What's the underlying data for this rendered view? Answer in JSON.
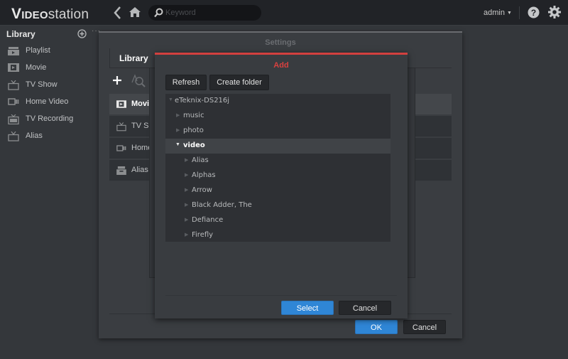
{
  "app": {
    "logo_v": "V",
    "logo_ideo": "IDEO",
    "logo_station": "station",
    "search_placeholder": "Keyword",
    "user": "admin",
    "icons": [
      "back-icon",
      "home-icon",
      "search-icon",
      "help-icon",
      "gear-icon"
    ]
  },
  "sidebar": {
    "title": "Library",
    "more": "···",
    "items": [
      {
        "label": "Playlist",
        "icon": "playlist-icon"
      },
      {
        "label": "Movie",
        "icon": "movie-icon"
      },
      {
        "label": "TV Show",
        "icon": "tv-icon"
      },
      {
        "label": "Home Video",
        "icon": "camera-icon"
      },
      {
        "label": "TV Recording",
        "icon": "tv-recording-icon"
      },
      {
        "label": "Alias",
        "icon": "tv-icon"
      }
    ]
  },
  "settings": {
    "title": "Settings",
    "tabs": [
      {
        "label": "Library"
      }
    ],
    "library_list": [
      {
        "label": "Movie",
        "selected": true
      },
      {
        "label": "TV Sh"
      },
      {
        "label": "Home"
      },
      {
        "label": "Alias"
      }
    ],
    "ok_label": "OK",
    "cancel_label": "Cancel"
  },
  "add_dialog": {
    "title": "Add",
    "refresh_label": "Refresh",
    "create_folder_label": "Create folder",
    "tree": [
      {
        "label": "eTeknix-DS216j",
        "level": 0,
        "expanded": true
      },
      {
        "label": "music",
        "level": 1,
        "expanded": false
      },
      {
        "label": "photo",
        "level": 1,
        "expanded": false
      },
      {
        "label": "video",
        "level": 1,
        "expanded": true,
        "selected": true
      },
      {
        "label": "Alias",
        "level": 2,
        "expanded": false
      },
      {
        "label": "Alphas",
        "level": 2,
        "expanded": false
      },
      {
        "label": "Arrow",
        "level": 2,
        "expanded": false
      },
      {
        "label": "Black Adder, The",
        "level": 2,
        "expanded": false
      },
      {
        "label": "Defiance",
        "level": 2,
        "expanded": false
      },
      {
        "label": "Firefly",
        "level": 2,
        "expanded": false
      }
    ],
    "select_label": "Select",
    "cancel_label": "Cancel"
  },
  "colors": {
    "accent_blue": "#2f86d6",
    "dialog_accent_red": "#d2403f"
  }
}
